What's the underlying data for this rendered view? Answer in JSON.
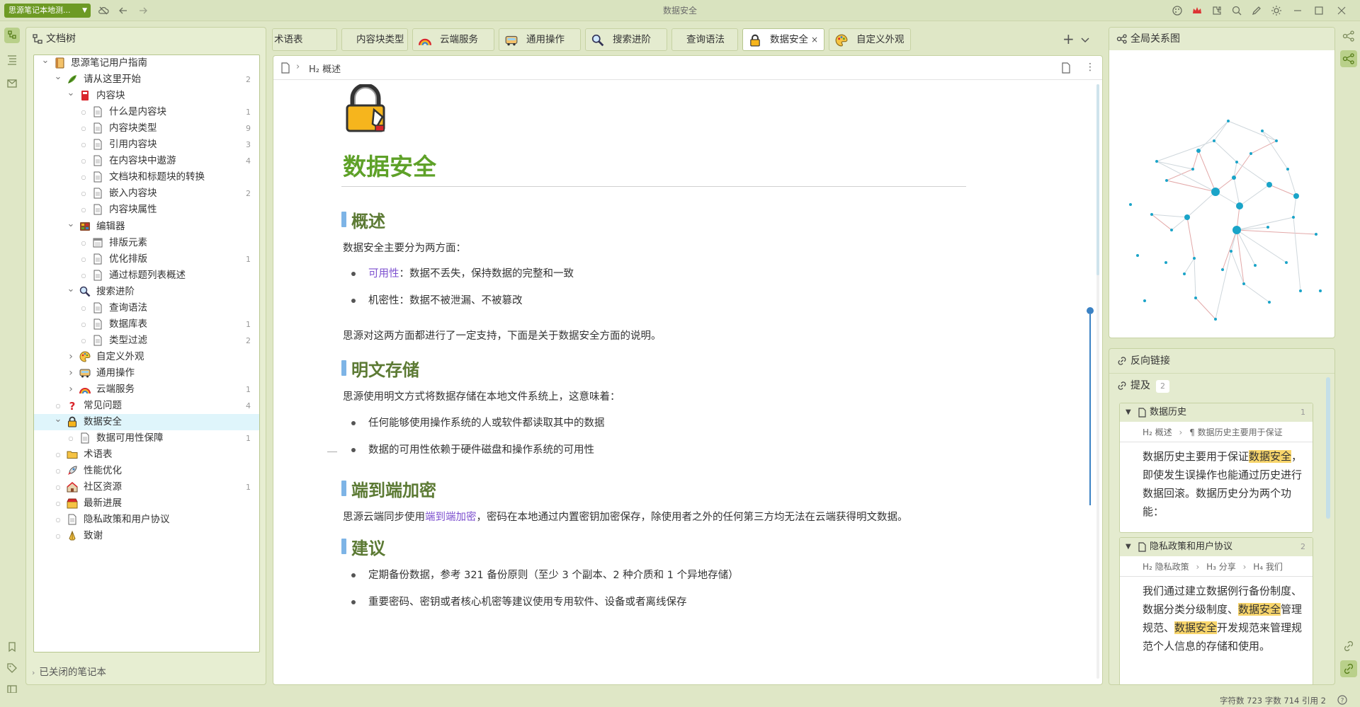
{
  "titlebar": {
    "notebook_select": "思源笔记本地测...",
    "title": "数据安全"
  },
  "file_tree": {
    "header": "文档树",
    "items": [
      {
        "label": "思源笔记用户指南",
        "level": 0,
        "arrow": "open",
        "icon": "book-icon",
        "count": ""
      },
      {
        "label": "请从这里开始",
        "level": 1,
        "arrow": "open",
        "icon": "leaf-icon",
        "count": "2"
      },
      {
        "label": "内容块",
        "level": 2,
        "arrow": "open",
        "icon": "red-book-icon",
        "count": ""
      },
      {
        "label": "什么是内容块",
        "level": 3,
        "arrow": "dot",
        "icon": "doc-icon",
        "count": "1"
      },
      {
        "label": "内容块类型",
        "level": 3,
        "arrow": "dot",
        "icon": "doc-icon",
        "count": "9"
      },
      {
        "label": "引用内容块",
        "level": 3,
        "arrow": "dot",
        "icon": "doc-icon",
        "count": "3"
      },
      {
        "label": "在内容块中遨游",
        "level": 3,
        "arrow": "dot",
        "icon": "doc-icon",
        "count": "4"
      },
      {
        "label": "文档块和标题块的转换",
        "level": 3,
        "arrow": "dot",
        "icon": "doc-icon",
        "count": ""
      },
      {
        "label": "嵌入内容块",
        "level": 3,
        "arrow": "dot",
        "icon": "doc-icon",
        "count": "2"
      },
      {
        "label": "内容块属性",
        "level": 3,
        "arrow": "dot",
        "icon": "doc-icon",
        "count": ""
      },
      {
        "label": "编辑器",
        "level": 2,
        "arrow": "open",
        "icon": "palette-icon",
        "count": ""
      },
      {
        "label": "排版元素",
        "level": 3,
        "arrow": "dot",
        "icon": "notepad-icon",
        "count": ""
      },
      {
        "label": "优化排版",
        "level": 3,
        "arrow": "dot",
        "icon": "doc-icon",
        "count": "1"
      },
      {
        "label": "通过标题列表概述",
        "level": 3,
        "arrow": "dot",
        "icon": "doc-icon",
        "count": ""
      },
      {
        "label": "搜索进阶",
        "level": 2,
        "arrow": "open",
        "icon": "magnifier-icon",
        "count": ""
      },
      {
        "label": "查询语法",
        "level": 3,
        "arrow": "dot",
        "icon": "doc-icon",
        "count": ""
      },
      {
        "label": "数据库表",
        "level": 3,
        "arrow": "dot",
        "icon": "doc-icon",
        "count": "1"
      },
      {
        "label": "类型过滤",
        "level": 3,
        "arrow": "dot",
        "icon": "doc-icon",
        "count": "2"
      },
      {
        "label": "自定义外观",
        "level": 2,
        "arrow": "closed",
        "icon": "art-palette-icon",
        "count": ""
      },
      {
        "label": "通用操作",
        "level": 2,
        "arrow": "closed",
        "icon": "bus-icon",
        "count": ""
      },
      {
        "label": "云端服务",
        "level": 2,
        "arrow": "closed",
        "icon": "rainbow-icon",
        "count": "1"
      },
      {
        "label": "常见问题",
        "level": 1,
        "arrow": "dot",
        "icon": "question-icon",
        "count": "4"
      },
      {
        "label": "数据安全",
        "level": 1,
        "arrow": "open",
        "icon": "lock-icon",
        "count": "",
        "selected": true
      },
      {
        "label": "数据可用性保障",
        "level": 2,
        "arrow": "dot",
        "icon": "doc-icon",
        "count": "1"
      },
      {
        "label": "术语表",
        "level": 1,
        "arrow": "dot",
        "icon": "folder-icon",
        "count": ""
      },
      {
        "label": "性能优化",
        "level": 1,
        "arrow": "dot",
        "icon": "rocket-icon",
        "count": ""
      },
      {
        "label": "社区资源",
        "level": 1,
        "arrow": "dot",
        "icon": "house-icon",
        "count": "1"
      },
      {
        "label": "最新进展",
        "level": 1,
        "arrow": "dot",
        "icon": "store-icon",
        "count": ""
      },
      {
        "label": "隐私政策和用户协议",
        "level": 1,
        "arrow": "dot",
        "icon": "doc-icon",
        "count": ""
      },
      {
        "label": "致谢",
        "level": 1,
        "arrow": "dot",
        "icon": "pray-icon",
        "count": ""
      }
    ],
    "closed_notebooks": "已关闭的笔记本"
  },
  "tabs": [
    {
      "label": "术语表",
      "icon": "",
      "active": false
    },
    {
      "label": "内容块类型",
      "icon": "",
      "active": false
    },
    {
      "label": "云端服务",
      "icon": "rainbow-icon",
      "active": false
    },
    {
      "label": "通用操作",
      "icon": "bus-icon",
      "active": false
    },
    {
      "label": "搜索进阶",
      "icon": "magnifier-icon",
      "active": false
    },
    {
      "label": "查询语法",
      "icon": "",
      "active": false
    },
    {
      "label": "数据安全",
      "icon": "lock-icon",
      "active": true
    },
    {
      "label": "自定义外观",
      "icon": "art-palette-icon",
      "active": false
    }
  ],
  "editor": {
    "breadcrumb": "H₂ 概述",
    "title": "数据安全",
    "sections": {
      "s1_heading": "概述",
      "s1_intro": "数据安全主要分为两方面：",
      "s1_li1_link": "可用性",
      "s1_li1_rest": "：数据不丢失，保持数据的完整和一致",
      "s1_li2": "机密性：数据不被泄漏、不被篡改",
      "s1_outro": "思源对这两方面都进行了一定支持，下面是关于数据安全方面的说明。",
      "s2_heading": "明文存储",
      "s2_intro": "思源使用明文方式将数据存储在本地文件系统上，这意味着：",
      "s2_li1": "任何能够使用操作系统的人或软件都读取其中的数据",
      "s2_li2": "数据的可用性依赖于硬件磁盘和操作系统的可用性",
      "s3_heading": "端到端加密",
      "s3_text_a": "思源云端同步使用",
      "s3_link": "端到端加密",
      "s3_text_b": "，密码在本地通过内置密钥加密保存，除使用者之外的任何第三方均无法在云端获得明文数据。",
      "s4_heading": "建议",
      "s4_li1": "定期备份数据，参考 321 备份原则（至少 3 个副本、2 种介质和 1 个异地存储）",
      "s4_li2": "重要密码、密钥或者核心机密等建议使用专用软件、设备或者离线保存"
    }
  },
  "graph": {
    "title": "全局关系图"
  },
  "backlinks": {
    "title": "反向链接",
    "mentions_label": "提及",
    "mentions_count": "2",
    "cards": [
      {
        "title": "数据历史",
        "count": "1",
        "breadcrumb_h": "H₂ 概述",
        "breadcrumb_p": "¶ 数据历史主要用于保证",
        "text_a": "数据历史主要用于保证",
        "text_hl": "数据安全",
        "text_b": "，即使发生误操作也能通过历史进行数据回滚。数据历史分为两个功能："
      },
      {
        "title": "隐私政策和用户协议",
        "count": "2",
        "breadcrumb_h": "H₂ 隐私政策",
        "breadcrumb_h3": "H₃ 分享",
        "breadcrumb_h4": "H₄ 我们",
        "text_a": "我们通过建立数据例行备份制度、数据分类分级制度、",
        "text_hl1": "数据安全",
        "text_m": "管理规范、",
        "text_hl2": "数据安全",
        "text_b": "开发规范来管理规范个人信息的存储和使用。"
      }
    ]
  },
  "status": {
    "text": "字符数 723  字数 714  引用 2"
  },
  "colors": {
    "accent": "#5ea128",
    "background": "#dfe7c6",
    "link": "#7c4fcf",
    "highlight": "#f8d56b"
  }
}
